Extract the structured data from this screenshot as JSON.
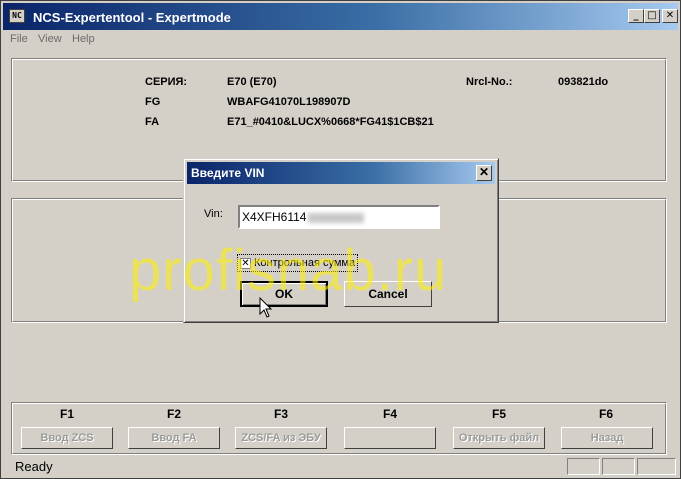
{
  "window": {
    "title": "NCS-Expertentool - Expertmode",
    "app_icon": "app-icon",
    "controls": {
      "minimize": "_",
      "maximize": "□",
      "close": "✕"
    }
  },
  "menu": {
    "items": [
      "File",
      "View",
      "Help"
    ]
  },
  "info": {
    "series_label": "СЕРИЯ:",
    "series_value": "E70 (E70)",
    "nrcl_label": "Nrcl-No.:",
    "nrcl_value": "093821do",
    "fg_label": "FG",
    "fg_value": "WBAFG41070L198907D",
    "fa_label": "FA",
    "fa_value": "E71_#0410&LUCX%0668*FG41$1CB$21"
  },
  "dialog": {
    "title": "Введите VIN",
    "close": "✕",
    "vin_label": "Vin:",
    "vin_value": "X4XFH6114",
    "checkbox_label": "Контрольная сумма",
    "checkbox_mark": "✕",
    "checkbox_checked": true,
    "ok_label": "OK",
    "cancel_label": "Cancel"
  },
  "fkeys": [
    {
      "key": "F1",
      "label": "Ввод ZCS"
    },
    {
      "key": "F2",
      "label": "Ввод FA"
    },
    {
      "key": "F3",
      "label": "ZCS/FA из ЭБУ"
    },
    {
      "key": "F4",
      "label": ""
    },
    {
      "key": "F5",
      "label": "Открыть файл"
    },
    {
      "key": "F6",
      "label": "Назад"
    }
  ],
  "status": {
    "text": "Ready"
  },
  "watermark": "profisnab.ru"
}
